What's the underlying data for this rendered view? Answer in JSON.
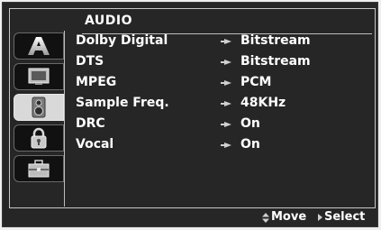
{
  "menu": {
    "title": "AUDIO",
    "tabs": [
      {
        "icon": "language-icon",
        "active": false
      },
      {
        "icon": "display-icon",
        "active": false
      },
      {
        "icon": "audio-speaker-icon",
        "active": true
      },
      {
        "icon": "lock-icon",
        "active": false
      },
      {
        "icon": "others-toolbox-icon",
        "active": false
      }
    ],
    "items": [
      {
        "label": "Dolby Digital",
        "value": "Bitstream"
      },
      {
        "label": "DTS",
        "value": "Bitstream"
      },
      {
        "label": "MPEG",
        "value": "PCM"
      },
      {
        "label": "Sample Freq.",
        "value": "48KHz"
      },
      {
        "label": "DRC",
        "value": "On"
      },
      {
        "label": "Vocal",
        "value": "On"
      }
    ]
  },
  "footer": {
    "move_label": "Move",
    "select_label": "Select"
  },
  "colors": {
    "background": "#262626",
    "text": "#ffffff",
    "active_tab": "#d9d9d9"
  }
}
